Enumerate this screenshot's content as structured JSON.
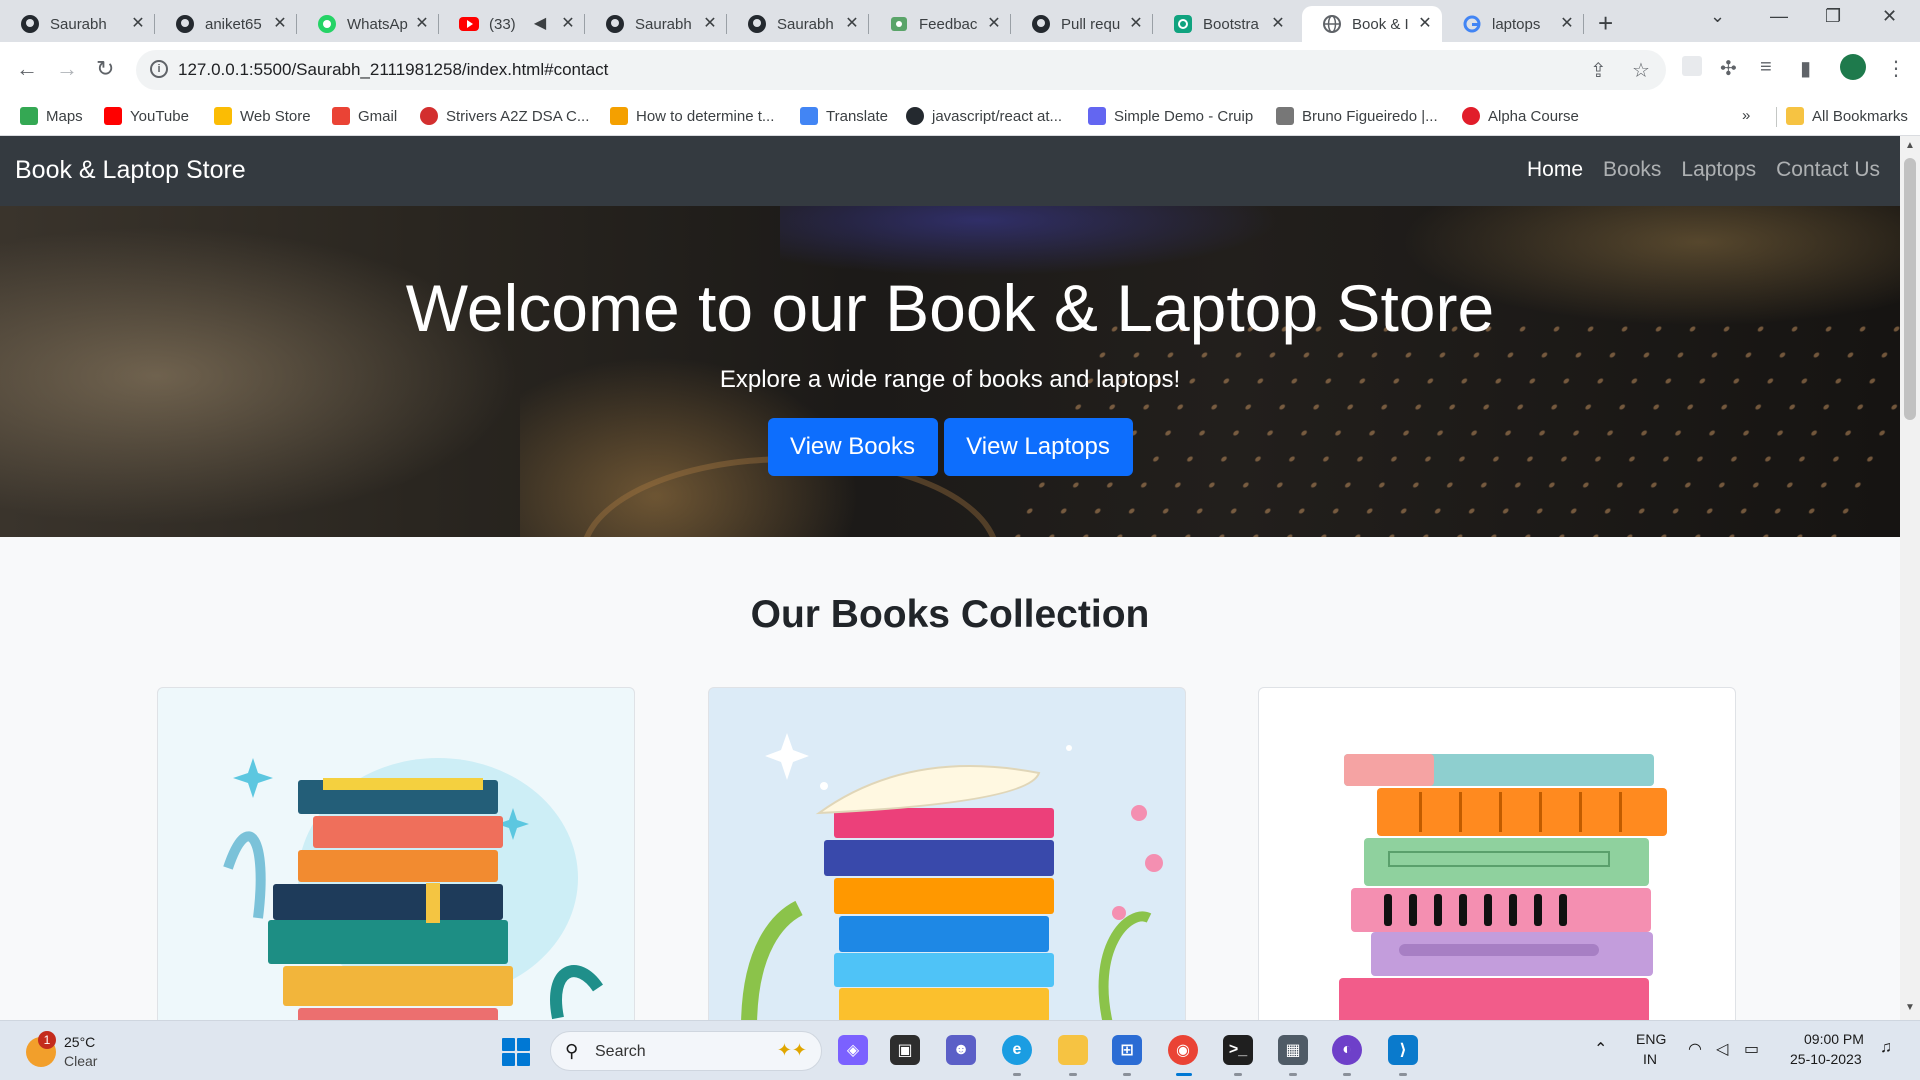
{
  "browser": {
    "tabs": [
      {
        "title": "Saurabh",
        "icon": "github-icon",
        "active": false
      },
      {
        "title": "aniket65",
        "icon": "github-icon",
        "active": false
      },
      {
        "title": "WhatsAp",
        "icon": "whatsapp-icon",
        "active": false
      },
      {
        "title": "(33)",
        "icon": "youtube-icon",
        "active": false,
        "muted": "◀"
      },
      {
        "title": "Saurabh",
        "icon": "github-icon",
        "active": false
      },
      {
        "title": "Saurabh",
        "icon": "github-icon",
        "active": false
      },
      {
        "title": "Feedbac",
        "icon": "feedback-icon",
        "active": false
      },
      {
        "title": "Pull requ",
        "icon": "github-icon",
        "active": false
      },
      {
        "title": "Bootstra",
        "icon": "chatgpt-icon",
        "active": false
      },
      {
        "title": "Book & I",
        "icon": "globe-icon",
        "active": true
      },
      {
        "title": "laptops",
        "icon": "google-icon",
        "active": false
      }
    ],
    "close_glyph": "✕",
    "new_tab_glyph": "+",
    "url": "127.0.0.1:5500/Saurabh_2111981258/index.html#contact",
    "bookmarks": [
      {
        "label": "Maps",
        "color": "#34a853"
      },
      {
        "label": "YouTube",
        "color": "#ff0000"
      },
      {
        "label": "Web Store",
        "color": "#fbbc04"
      },
      {
        "label": "Gmail",
        "color": "#ea4335"
      },
      {
        "label": "Strivers A2Z DSA C...",
        "color": "#d32f2f"
      },
      {
        "label": "How to determine t...",
        "color": "#f4a000"
      },
      {
        "label": "Translate",
        "color": "#4285f4"
      },
      {
        "label": "javascript/react at...",
        "color": "#24292f"
      },
      {
        "label": "Simple Demo - Cruip",
        "color": "#6366f1"
      },
      {
        "label": "Bruno Figueiredo |...",
        "color": "#777777"
      },
      {
        "label": "Alpha Course",
        "color": "#e11d2a"
      }
    ],
    "bookmarks_overflow": "»",
    "all_bookmarks": "All Bookmarks"
  },
  "site": {
    "brand": "Book & Laptop Store",
    "nav": [
      "Home",
      "Books",
      "Laptops",
      "Contact Us"
    ],
    "hero_title": "Welcome to our Book & Laptop Store",
    "hero_subtitle": "Explore a wide range of books and laptops!",
    "btn_books": "View Books",
    "btn_laptops": "View Laptops",
    "section_title": "Our Books Collection"
  },
  "taskbar": {
    "weather_badge": "1",
    "temperature": "25°C",
    "condition": "Clear",
    "search_label": "Search",
    "lang_1": "ENG",
    "lang_2": "IN",
    "time": "09:00 PM",
    "date": "25-10-2023"
  },
  "colors": {
    "primary_button": "#0d6efd",
    "navbar": "#343a40",
    "page_bg": "#f8f9fa"
  }
}
